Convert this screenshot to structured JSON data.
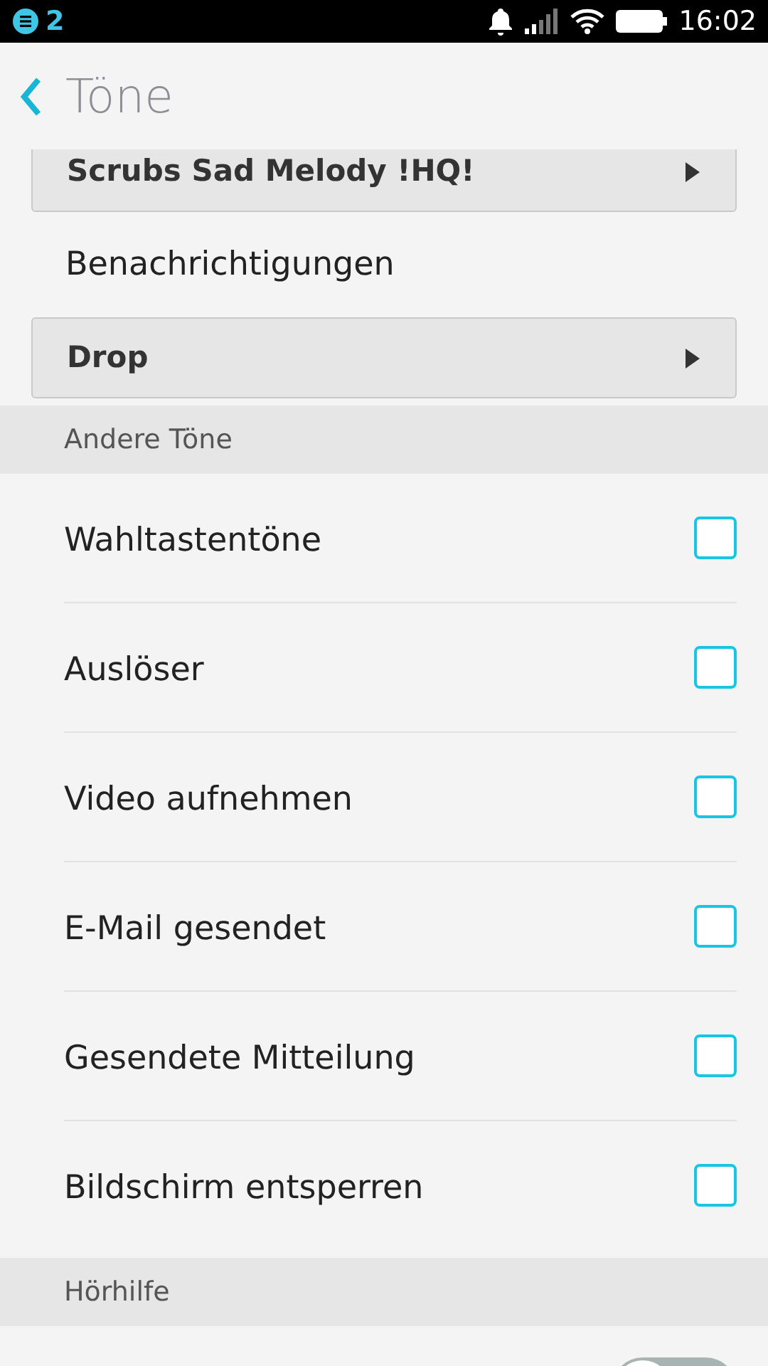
{
  "status_bar": {
    "notification_count": "2",
    "time": "16:02"
  },
  "header": {
    "title": "Töne"
  },
  "tone_selects": [
    {
      "value": "Scrubs Sad Melody !HQ!"
    },
    {
      "label": "Benachrichtigungen",
      "value": "Drop"
    }
  ],
  "sections": [
    {
      "title": "Andere Töne",
      "items": [
        {
          "label": "Wahltastentöne",
          "kind": "checkbox",
          "checked": false
        },
        {
          "label": "Auslöser",
          "kind": "checkbox",
          "checked": false
        },
        {
          "label": "Video aufnehmen",
          "kind": "checkbox",
          "checked": false
        },
        {
          "label": "E-Mail gesendet",
          "kind": "checkbox",
          "checked": false
        },
        {
          "label": "Gesendete Mitteilung",
          "kind": "checkbox",
          "checked": false
        },
        {
          "label": "Bildschirm entsperren",
          "kind": "checkbox",
          "checked": false
        }
      ]
    },
    {
      "title": "Hörhilfe",
      "items": [
        {
          "kind": "toggle",
          "on": false
        }
      ]
    }
  ]
}
